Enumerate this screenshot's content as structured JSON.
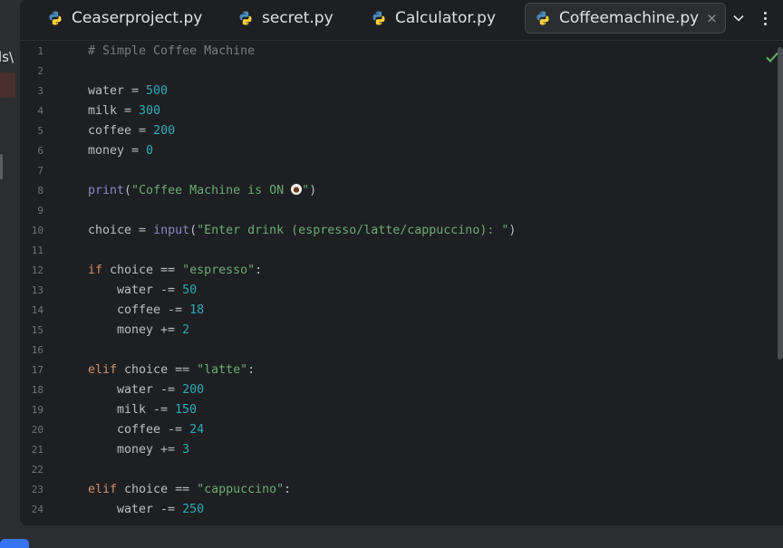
{
  "sidebar_fragment": "ls\\",
  "tabs": [
    {
      "label": "Ceaserproject.py",
      "active": false
    },
    {
      "label": "secret.py",
      "active": false
    },
    {
      "label": "Calculator.py",
      "active": false
    },
    {
      "label": "Coffeemachine.py",
      "active": true
    }
  ],
  "close_glyph": "×",
  "icons": {
    "tab_file": "python-icon",
    "more": "chevron-down-icon",
    "options": "more-vertical-icon",
    "status": "check-icon"
  },
  "colors": {
    "keyword": "#cf8e6d",
    "number": "#2aacb8",
    "string": "#6aab73",
    "builtin": "#8888c6",
    "comment": "#7a7e85",
    "check": "#5fb865"
  },
  "code_lines": [
    {
      "n": "1",
      "indent": 0,
      "tokens": [
        {
          "t": "cm",
          "v": "# Simple Coffee Machine"
        }
      ]
    },
    {
      "n": "2",
      "indent": 0,
      "tokens": []
    },
    {
      "n": "3",
      "indent": 0,
      "tokens": [
        {
          "t": "p",
          "v": "water = "
        },
        {
          "t": "num",
          "v": "500"
        }
      ]
    },
    {
      "n": "4",
      "indent": 0,
      "tokens": [
        {
          "t": "p",
          "v": "milk = "
        },
        {
          "t": "num",
          "v": "300"
        }
      ]
    },
    {
      "n": "5",
      "indent": 0,
      "tokens": [
        {
          "t": "p",
          "v": "coffee = "
        },
        {
          "t": "num",
          "v": "200"
        }
      ]
    },
    {
      "n": "6",
      "indent": 0,
      "tokens": [
        {
          "t": "p",
          "v": "money = "
        },
        {
          "t": "num",
          "v": "0"
        }
      ]
    },
    {
      "n": "7",
      "indent": 0,
      "tokens": []
    },
    {
      "n": "8",
      "indent": 0,
      "tokens": [
        {
          "t": "fn",
          "v": "print"
        },
        {
          "t": "p",
          "v": "("
        },
        {
          "t": "str",
          "v": "\"Coffee Machine is ON "
        },
        {
          "t": "cup",
          "v": ""
        },
        {
          "t": "str",
          "v": "\""
        },
        {
          "t": "p",
          "v": ")"
        }
      ]
    },
    {
      "n": "9",
      "indent": 0,
      "tokens": []
    },
    {
      "n": "10",
      "indent": 0,
      "tokens": [
        {
          "t": "p",
          "v": "choice = "
        },
        {
          "t": "fn",
          "v": "input"
        },
        {
          "t": "p",
          "v": "("
        },
        {
          "t": "str",
          "v": "\"Enter drink (espresso/latte/cappuccino): \""
        },
        {
          "t": "p",
          "v": ")"
        }
      ]
    },
    {
      "n": "11",
      "indent": 0,
      "tokens": []
    },
    {
      "n": "12",
      "indent": 0,
      "tokens": [
        {
          "t": "kw",
          "v": "if"
        },
        {
          "t": "p",
          "v": " choice == "
        },
        {
          "t": "str",
          "v": "\"espresso\""
        },
        {
          "t": "p",
          "v": ":"
        }
      ]
    },
    {
      "n": "13",
      "indent": 1,
      "tokens": [
        {
          "t": "p",
          "v": "water -= "
        },
        {
          "t": "num",
          "v": "50"
        }
      ]
    },
    {
      "n": "14",
      "indent": 1,
      "tokens": [
        {
          "t": "p",
          "v": "coffee -= "
        },
        {
          "t": "num",
          "v": "18"
        }
      ]
    },
    {
      "n": "15",
      "indent": 1,
      "tokens": [
        {
          "t": "p",
          "v": "money += "
        },
        {
          "t": "num",
          "v": "2"
        }
      ]
    },
    {
      "n": "16",
      "indent": 0,
      "tokens": []
    },
    {
      "n": "17",
      "indent": 0,
      "tokens": [
        {
          "t": "kw",
          "v": "elif"
        },
        {
          "t": "p",
          "v": " choice == "
        },
        {
          "t": "str",
          "v": "\"latte\""
        },
        {
          "t": "p",
          "v": ":"
        }
      ]
    },
    {
      "n": "18",
      "indent": 1,
      "tokens": [
        {
          "t": "p",
          "v": "water -= "
        },
        {
          "t": "num",
          "v": "200"
        }
      ]
    },
    {
      "n": "19",
      "indent": 1,
      "tokens": [
        {
          "t": "p",
          "v": "milk -= "
        },
        {
          "t": "num",
          "v": "150"
        }
      ]
    },
    {
      "n": "20",
      "indent": 1,
      "tokens": [
        {
          "t": "p",
          "v": "coffee -= "
        },
        {
          "t": "num",
          "v": "24"
        }
      ]
    },
    {
      "n": "21",
      "indent": 1,
      "tokens": [
        {
          "t": "p",
          "v": "money += "
        },
        {
          "t": "num",
          "v": "3"
        }
      ]
    },
    {
      "n": "22",
      "indent": 0,
      "tokens": []
    },
    {
      "n": "23",
      "indent": 0,
      "tokens": [
        {
          "t": "kw",
          "v": "elif"
        },
        {
          "t": "p",
          "v": " choice == "
        },
        {
          "t": "str",
          "v": "\"cappuccino\""
        },
        {
          "t": "p",
          "v": ":"
        }
      ]
    },
    {
      "n": "24",
      "indent": 1,
      "tokens": [
        {
          "t": "p",
          "v": "water -= "
        },
        {
          "t": "num",
          "v": "250"
        }
      ]
    }
  ]
}
